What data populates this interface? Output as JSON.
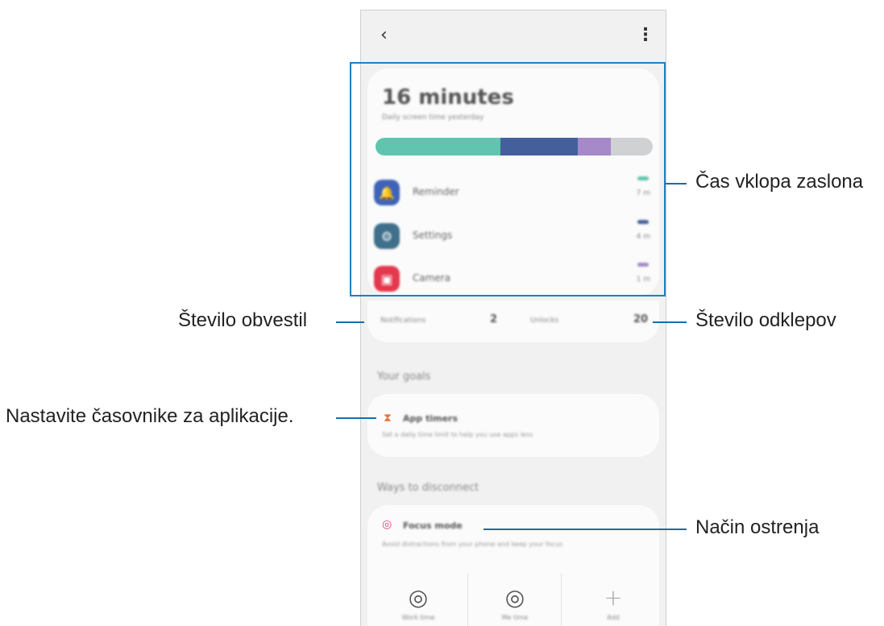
{
  "topbar": {
    "back_icon": "‹",
    "menu_icon": "⋮"
  },
  "screen_time": {
    "total": "16 minutes",
    "subtitle": "Daily screen time yesterday"
  },
  "usage_bar": {
    "segments": [
      {
        "name": "Reminder",
        "fraction": 0.45,
        "color": "#5fc5ae"
      },
      {
        "name": "Settings",
        "fraction": 0.28,
        "color": "#44609c"
      },
      {
        "name": "Camera",
        "fraction": 0.12,
        "color": "#a589c8"
      },
      {
        "name": "Other",
        "fraction": 0.15,
        "color": "#cfd1d3"
      }
    ]
  },
  "apps": [
    {
      "name": "Reminder",
      "time": "7 m",
      "icon": "bell-icon",
      "color": "#3f63b8",
      "dash_color": "#5fc5ae"
    },
    {
      "name": "Settings",
      "time": "4 m",
      "icon": "gear-icon",
      "color": "#3f6f8a",
      "dash_color": "#44609c"
    },
    {
      "name": "Camera",
      "time": "1 m",
      "icon": "camera-icon",
      "color": "#e3384d",
      "dash_color": "#a589c8"
    }
  ],
  "stats": {
    "notifications_label": "Notifications",
    "notifications_value": "2",
    "unlocks_label": "Unlocks",
    "unlocks_value": "20"
  },
  "goals": {
    "title": "Your goals",
    "app_timers_title": "App timers",
    "app_timers_desc": "Set a daily time limit to help you use apps less"
  },
  "disconnect": {
    "title": "Ways to disconnect",
    "focus_title": "Focus mode",
    "focus_desc": "Avoid distractions from your phone and keep your focus"
  },
  "tools": [
    {
      "label": "Work time",
      "icon": "work-focus-icon"
    },
    {
      "label": "Me time",
      "icon": "me-focus-icon"
    },
    {
      "label": "Add",
      "icon": "plus-icon"
    }
  ],
  "callouts": {
    "screen_on_time": "Čas vklopa zaslona",
    "notifications_count": "Število obvestil",
    "unlocks_count": "Število odklepov",
    "app_timers": "Nastavite časovnike za aplikacije.",
    "focus_mode": "Način ostrenja"
  }
}
